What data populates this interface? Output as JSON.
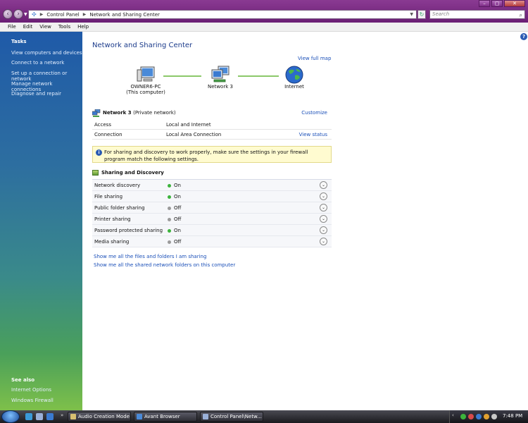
{
  "address_bar": {
    "segments": [
      "Control Panel",
      "Network and Sharing Center"
    ],
    "search_placeholder": "Search"
  },
  "menu": [
    "File",
    "Edit",
    "View",
    "Tools",
    "Help"
  ],
  "left_pane": {
    "tasks_title": "Tasks",
    "tasks": [
      "View computers and devices",
      "Connect to a network",
      "Set up a connection or network",
      "Manage network connections",
      "Diagnose and repair"
    ],
    "see_also_title": "See also",
    "see_also": [
      "Internet Options",
      "Windows Firewall"
    ]
  },
  "main": {
    "title": "Network and Sharing Center",
    "view_full_map": "View full map",
    "map": {
      "computer_name": "OWNER6-PC",
      "computer_sub": "(This computer)",
      "network": "Network  3",
      "internet": "Internet"
    },
    "network": {
      "name": "Network  3",
      "type": "(Private network)",
      "customize": "Customize",
      "rows": [
        {
          "key": "Access",
          "value": "Local and Internet",
          "action": ""
        },
        {
          "key": "Connection",
          "value": "Local Area Connection",
          "action": "View status"
        }
      ]
    },
    "info_message": "For sharing and discovery to work properly, make sure the settings in your firewall program match the following settings.",
    "sharing": {
      "title": "Sharing and Discovery",
      "rows": [
        {
          "label": "Network discovery",
          "state": "On",
          "on": true
        },
        {
          "label": "File sharing",
          "state": "On",
          "on": true
        },
        {
          "label": "Public folder sharing",
          "state": "Off",
          "on": false
        },
        {
          "label": "Printer sharing",
          "state": "Off",
          "on": false
        },
        {
          "label": "Password protected sharing",
          "state": "On",
          "on": true
        },
        {
          "label": "Media sharing",
          "state": "Off",
          "on": false
        }
      ]
    },
    "links": [
      "Show me all the files and folders I am sharing",
      "Show me all the shared network folders on this computer"
    ]
  },
  "taskbar": {
    "tasks": [
      "Audio Creation Mode",
      "Avant Browser",
      "Control Panel\\Netw..."
    ],
    "clock": "7:48 PM"
  },
  "colors": {
    "title_bar": "#7a2a84",
    "link": "#1a4fb8",
    "status_on": "#3cb33c",
    "status_off": "#9a9a9a"
  }
}
